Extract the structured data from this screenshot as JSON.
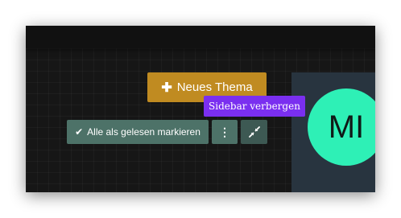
{
  "toolbar": {
    "new_topic_label": "Neues Thema",
    "mark_all_read_label": "Alle als gelesen markieren",
    "more_glyph": "⋮"
  },
  "tooltip": {
    "text": "Sidebar verbergen"
  },
  "sidebar": {
    "avatar_initials": "MI"
  },
  "colors": {
    "new_topic_button": "#c08b21",
    "mark_read_button": "#4d7268",
    "tooltip": "#7a2ff0",
    "avatar": "#2ef0b6",
    "sidebar_panel": "#28343f",
    "background": "#161616"
  },
  "icons": {
    "new_topic": "plus-icon",
    "mark_read": "check-icon",
    "more": "vertical-ellipsis-icon",
    "collapse": "compress-arrows-icon"
  }
}
